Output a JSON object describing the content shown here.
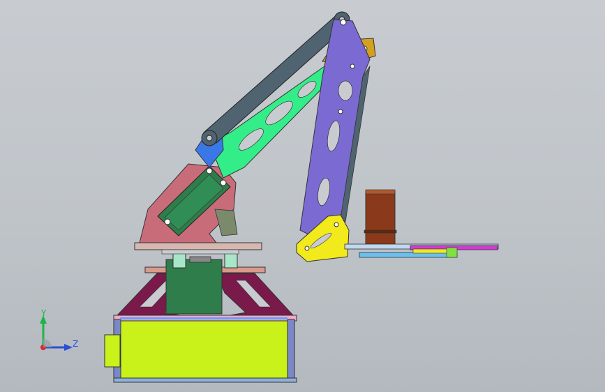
{
  "view": {
    "background_top": "#c8ccd1",
    "background_bottom": "#b4b9bf"
  },
  "triad": {
    "y_label": "Y",
    "z_label": "Z",
    "y_color": "#1fb34a",
    "z_color": "#2a4fd6",
    "origin_color": "#d62a2a"
  },
  "colors": {
    "base_box": "#c8f21a",
    "base_frame": "#7a1a4a",
    "servo_green": "#2f7d4b",
    "pink_bracket": "#c96c7a",
    "link_gray": "#4f6470",
    "arm_green": "#33ee88",
    "arm_purple": "#7a6ad2",
    "yellow_plate": "#f2ea1a",
    "gold_link": "#d4a020",
    "gripper_brown": "#8a3a1a",
    "gripper_magenta": "#d23ad2"
  }
}
